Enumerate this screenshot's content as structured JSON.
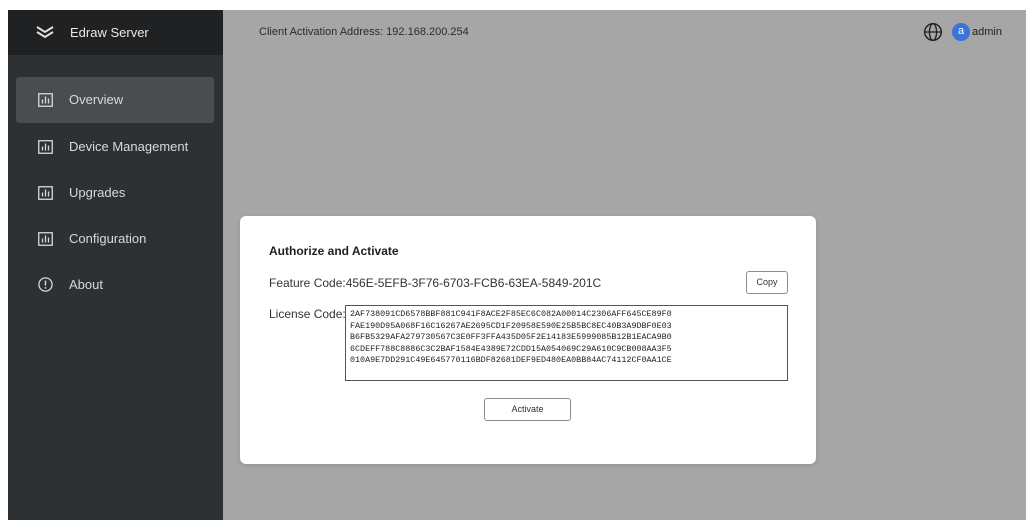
{
  "brand": {
    "name": "Edraw Server",
    "icon": "layers-icon"
  },
  "sidebar": {
    "items": [
      {
        "label": "Overview",
        "icon": "bar-chart-icon",
        "active": true
      },
      {
        "label": "Device Management",
        "icon": "bar-chart-icon",
        "active": false
      },
      {
        "label": "Upgrades",
        "icon": "bar-chart-icon",
        "active": false
      },
      {
        "label": "Configuration",
        "icon": "bar-chart-icon",
        "active": false
      },
      {
        "label": "About",
        "icon": "info-circle-icon",
        "active": false
      }
    ]
  },
  "topbar": {
    "address": "Client Activation Address: 192.168.200.254",
    "avatar_letter": "a",
    "username": "admin",
    "language_icon": "globe-icon"
  },
  "dialog": {
    "title": "Authorize and Activate",
    "feature_code_text": "Feature Code:456E-5EFB-3F76-6703-FCB6-63EA-5849-201C",
    "copy_label": "Copy",
    "license_label": "License Code:",
    "license_value": "2AF738091CD6578BBF881C941F8ACE2F85EC6C082A00014C2306AFF645CE89F0\nFAE190D95A068F16C16267AE2695CD1F20958E590E25B5BC8EC40B3A9DBF0E03\nB6FB5329AFA279730567C3E0FF3FFA435D05F2E14183E5999085B12B1EACA9B0\n6CDEFF788C8886C3C2BAF1584E4389E72CDD15A054069C29A610C9CB008AA3F5\n010A9E7DD291C49E645770116BDF82681DEF9ED480EA0BB84AC74112CF0AA1CE",
    "activate_label": "Activate"
  },
  "colors": {
    "sidebar_bg": "#2e3133",
    "brand_bg": "#1f2123",
    "active_item_bg": "#4a4d50",
    "content_overlay": "#a6a6a6",
    "avatar": "#3c73d9"
  }
}
